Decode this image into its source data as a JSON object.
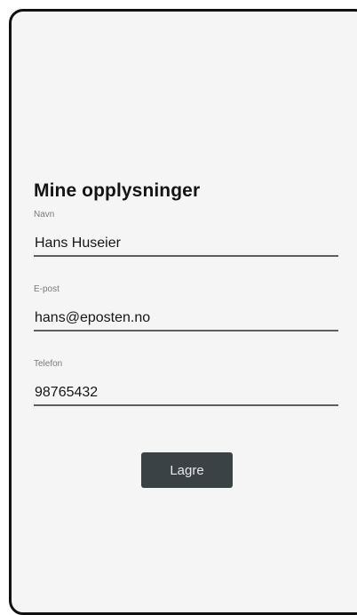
{
  "profile": {
    "title": "Mine opplysninger",
    "fields": {
      "name": {
        "label": "Navn",
        "value": "Hans Huseier"
      },
      "email": {
        "label": "E-post",
        "value": "hans@eposten.no"
      },
      "phone": {
        "label": "Telefon",
        "value": "98765432"
      }
    },
    "save_label": "Lagre"
  },
  "colors": {
    "background": "#f5f5f5",
    "frame": "#111111",
    "button": "#3b4246",
    "button_text": "#e8e8e8",
    "underline": "#5f5f5f",
    "label": "#7a7a7a"
  }
}
